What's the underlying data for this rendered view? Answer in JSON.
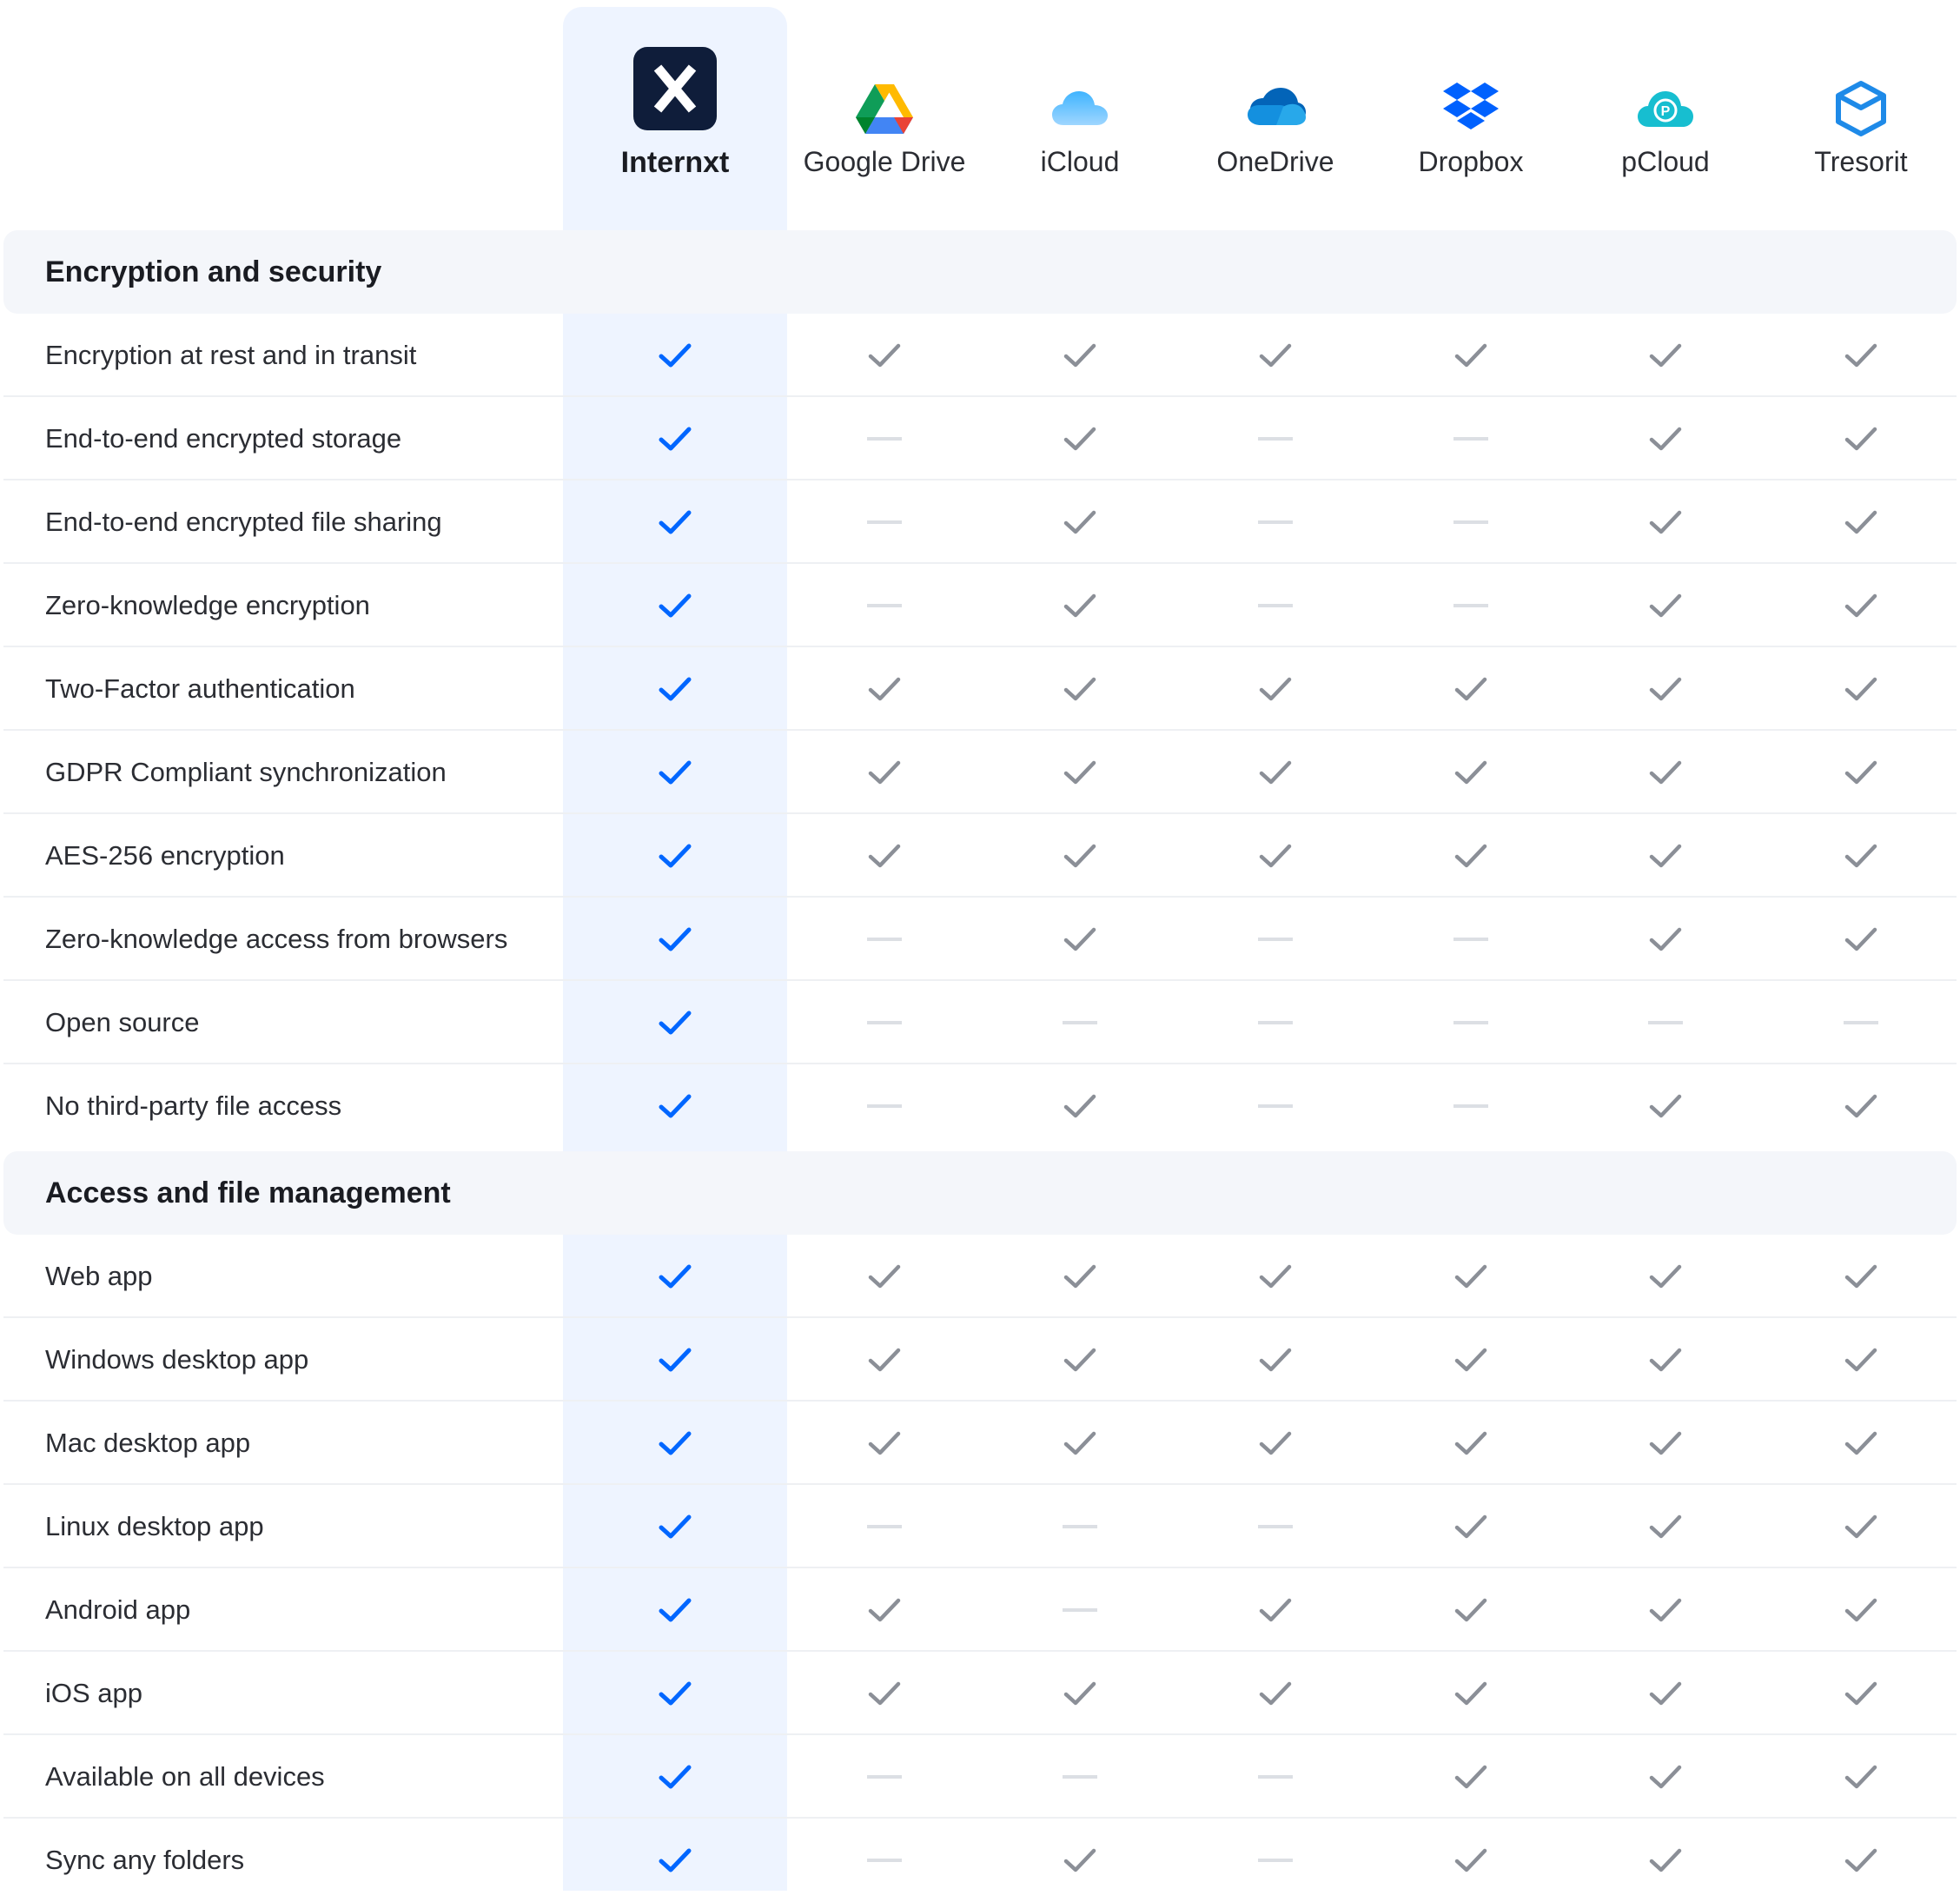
{
  "providers": [
    {
      "name": "Internxt",
      "logo": "internxt-logo",
      "highlight": true
    },
    {
      "name": "Google Drive",
      "logo": "google-drive-logo"
    },
    {
      "name": "iCloud",
      "logo": "icloud-logo"
    },
    {
      "name": "OneDrive",
      "logo": "onedrive-logo"
    },
    {
      "name": "Dropbox",
      "logo": "dropbox-logo"
    },
    {
      "name": "pCloud",
      "logo": "pcloud-logo"
    },
    {
      "name": "Tresorit",
      "logo": "tresorit-logo"
    }
  ],
  "colors": {
    "accent_check": "#0066ff",
    "gray_check": "#8b8f97",
    "dash": "#dcdfe4",
    "highlight_bg": "#eef4ff",
    "section_bg": "#f4f6fa"
  },
  "sections": [
    {
      "title": "Encryption and security",
      "rows": [
        {
          "label": "Encryption at rest and in transit",
          "values": [
            true,
            true,
            true,
            true,
            true,
            true,
            true
          ]
        },
        {
          "label": "End-to-end encrypted storage",
          "values": [
            true,
            false,
            true,
            false,
            false,
            true,
            true
          ]
        },
        {
          "label": "End-to-end encrypted file sharing",
          "values": [
            true,
            false,
            true,
            false,
            false,
            true,
            true
          ]
        },
        {
          "label": "Zero-knowledge encryption",
          "values": [
            true,
            false,
            true,
            false,
            false,
            true,
            true
          ]
        },
        {
          "label": "Two-Factor authentication",
          "values": [
            true,
            true,
            true,
            true,
            true,
            true,
            true
          ]
        },
        {
          "label": "GDPR Compliant synchronization",
          "values": [
            true,
            true,
            true,
            true,
            true,
            true,
            true
          ]
        },
        {
          "label": "AES-256 encryption",
          "values": [
            true,
            true,
            true,
            true,
            true,
            true,
            true
          ]
        },
        {
          "label": "Zero-knowledge access from browsers",
          "values": [
            true,
            false,
            true,
            false,
            false,
            true,
            true
          ]
        },
        {
          "label": "Open source",
          "values": [
            true,
            false,
            false,
            false,
            false,
            false,
            false
          ]
        },
        {
          "label": "No third-party file access",
          "values": [
            true,
            false,
            true,
            false,
            false,
            true,
            true
          ]
        }
      ]
    },
    {
      "title": "Access and file management",
      "rows": [
        {
          "label": "Web app",
          "values": [
            true,
            true,
            true,
            true,
            true,
            true,
            true
          ]
        },
        {
          "label": "Windows desktop app",
          "values": [
            true,
            true,
            true,
            true,
            true,
            true,
            true
          ]
        },
        {
          "label": "Mac desktop app",
          "values": [
            true,
            true,
            true,
            true,
            true,
            true,
            true
          ]
        },
        {
          "label": "Linux desktop app",
          "values": [
            true,
            false,
            false,
            false,
            true,
            true,
            true
          ]
        },
        {
          "label": "Android app",
          "values": [
            true,
            true,
            false,
            true,
            true,
            true,
            true
          ]
        },
        {
          "label": "iOS app",
          "values": [
            true,
            true,
            true,
            true,
            true,
            true,
            true
          ]
        },
        {
          "label": "Available on all devices",
          "values": [
            true,
            false,
            false,
            false,
            true,
            true,
            true
          ]
        },
        {
          "label": "Sync any folders",
          "values": [
            true,
            false,
            true,
            false,
            true,
            true,
            true
          ]
        }
      ]
    }
  ]
}
